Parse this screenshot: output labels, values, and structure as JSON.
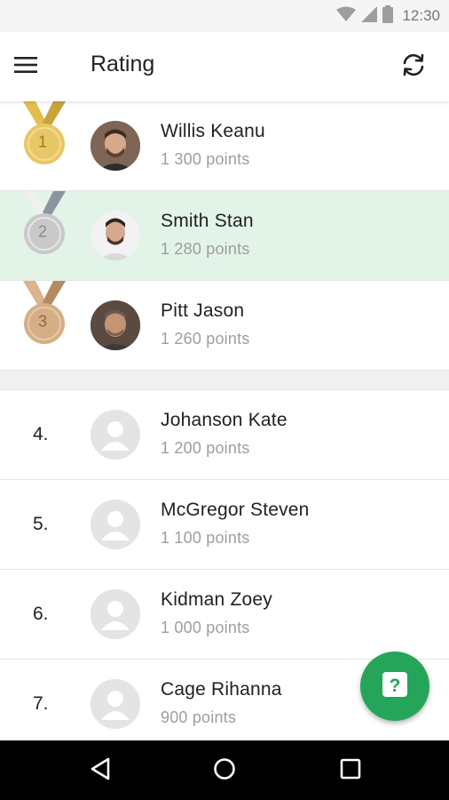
{
  "status_bar": {
    "time": "12:30"
  },
  "app_bar": {
    "title": "Rating"
  },
  "podium": [
    {
      "medal_label": "1",
      "name": "Willis Keanu",
      "points": "1 300 points",
      "highlighted": false,
      "medal": "gold"
    },
    {
      "medal_label": "2",
      "name": "Smith Stan",
      "points": "1 280 points",
      "highlighted": true,
      "medal": "silver"
    },
    {
      "medal_label": "3",
      "name": "Pitt Jason",
      "points": "1 260 points",
      "highlighted": false,
      "medal": "bronze"
    }
  ],
  "ranking": [
    {
      "rank": "4.",
      "name": "Johanson Kate",
      "points": "1 200 points"
    },
    {
      "rank": "5.",
      "name": "McGregor Steven",
      "points": "1 100 points"
    },
    {
      "rank": "6.",
      "name": "Kidman Zoey",
      "points": "1 000 points"
    },
    {
      "rank": "7.",
      "name": "Cage Rihanna",
      "points": "900 points"
    }
  ],
  "fab": {
    "icon": "question-icon",
    "label": "?"
  },
  "colors": {
    "accent": "#25a55a",
    "highlight_row": "#e2f3e8",
    "gold": "#d9b24a",
    "silver": "#b9b9b9",
    "bronze": "#c9a27a"
  },
  "icons": {
    "status": [
      "wifi-icon",
      "signal-icon",
      "battery-icon"
    ],
    "app_bar": [
      "menu-icon",
      "refresh-icon"
    ],
    "nav": [
      "back-icon",
      "home-icon",
      "recents-icon"
    ]
  }
}
